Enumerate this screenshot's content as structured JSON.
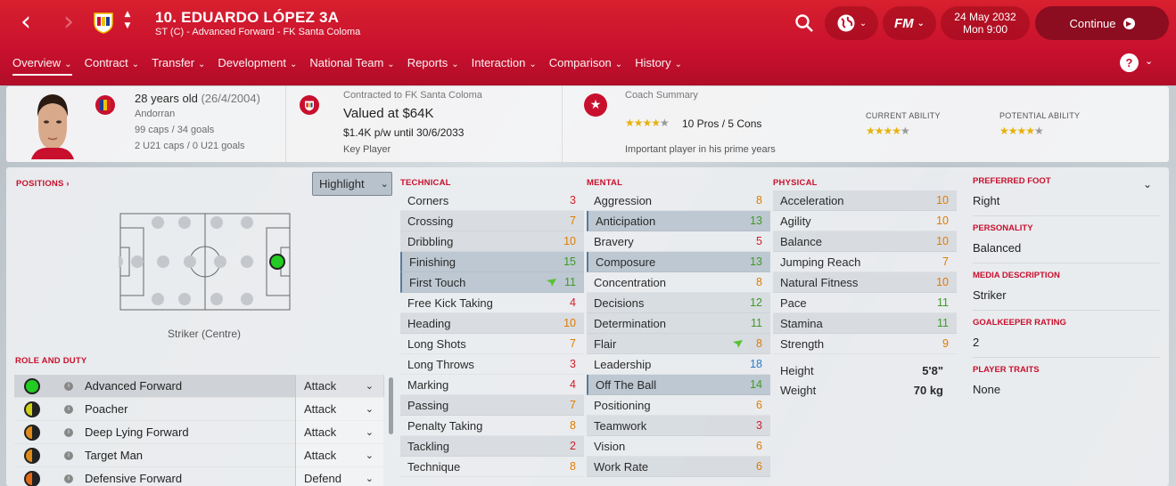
{
  "header": {
    "player_title": "10. EDUARDO LÓPEZ 3A",
    "player_subtitle": "ST (C) - Advanced Forward - FK Santa Coloma",
    "date": "24 May 2032",
    "time": "Mon 9:00",
    "fm_label": "FM",
    "continue_label": "Continue"
  },
  "tabs": [
    "Overview",
    "Contract",
    "Transfer",
    "Development",
    "National Team",
    "Reports",
    "Interaction",
    "Comparison",
    "History"
  ],
  "summary": {
    "age": "28 years old",
    "dob": "(26/4/2004)",
    "nationality": "Andorran",
    "caps": "99 caps / 34 goals",
    "u21_caps": "2 U21 caps / 0 U21 goals",
    "contracted": "Contracted to FK Santa Coloma",
    "value": "Valued at $64K",
    "wage": "$1.4K p/w until 30/6/2033",
    "squad_status": "Key Player",
    "coach_title": "Coach Summary",
    "coach_stars": 4,
    "pros_cons": "10 Pros / 5 Cons",
    "coach_note": "Important player in his prime years",
    "current_ability_label": "CURRENT ABILITY",
    "current_ability_stars": 4,
    "potential_ability_label": "POTENTIAL ABILITY",
    "potential_ability_stars": 4
  },
  "positions": {
    "title": "POSITIONS",
    "highlight_label": "Highlight",
    "position_label": "Striker (Centre)"
  },
  "role_duty": {
    "title": "ROLE AND DUTY",
    "roles": [
      {
        "name": "Advanced Forward",
        "duty": "Attack",
        "color": "#22cc22"
      },
      {
        "name": "Poacher",
        "duty": "Attack",
        "color": "#cfcf1a"
      },
      {
        "name": "Deep Lying Forward",
        "duty": "Attack",
        "color": "#e08a18"
      },
      {
        "name": "Target Man",
        "duty": "Attack",
        "color": "#e08a18"
      },
      {
        "name": "Defensive Forward",
        "duty": "Defend",
        "color": "#e06a18"
      }
    ]
  },
  "technical": {
    "title": "TECHNICAL",
    "attrs": [
      {
        "name": "Corners",
        "value": "3"
      },
      {
        "name": "Crossing",
        "value": "7"
      },
      {
        "name": "Dribbling",
        "value": "10"
      },
      {
        "name": "Finishing",
        "value": "15"
      },
      {
        "name": "First Touch",
        "value": "11"
      },
      {
        "name": "Free Kick Taking",
        "value": "4"
      },
      {
        "name": "Heading",
        "value": "10"
      },
      {
        "name": "Long Shots",
        "value": "7"
      },
      {
        "name": "Long Throws",
        "value": "3"
      },
      {
        "name": "Marking",
        "value": "4"
      },
      {
        "name": "Passing",
        "value": "7"
      },
      {
        "name": "Penalty Taking",
        "value": "8"
      },
      {
        "name": "Tackling",
        "value": "2"
      },
      {
        "name": "Technique",
        "value": "8"
      }
    ]
  },
  "mental": {
    "title": "MENTAL",
    "attrs": [
      {
        "name": "Aggression",
        "value": "8"
      },
      {
        "name": "Anticipation",
        "value": "13"
      },
      {
        "name": "Bravery",
        "value": "5"
      },
      {
        "name": "Composure",
        "value": "13"
      },
      {
        "name": "Concentration",
        "value": "8"
      },
      {
        "name": "Decisions",
        "value": "12"
      },
      {
        "name": "Determination",
        "value": "11"
      },
      {
        "name": "Flair",
        "value": "8"
      },
      {
        "name": "Leadership",
        "value": "18"
      },
      {
        "name": "Off The Ball",
        "value": "14"
      },
      {
        "name": "Positioning",
        "value": "6"
      },
      {
        "name": "Teamwork",
        "value": "3"
      },
      {
        "name": "Vision",
        "value": "6"
      },
      {
        "name": "Work Rate",
        "value": "6"
      }
    ]
  },
  "physical": {
    "title": "PHYSICAL",
    "attrs": [
      {
        "name": "Acceleration",
        "value": "10"
      },
      {
        "name": "Agility",
        "value": "10"
      },
      {
        "name": "Balance",
        "value": "10"
      },
      {
        "name": "Jumping Reach",
        "value": "7"
      },
      {
        "name": "Natural Fitness",
        "value": "10"
      },
      {
        "name": "Pace",
        "value": "11"
      },
      {
        "name": "Stamina",
        "value": "11"
      },
      {
        "name": "Strength",
        "value": "9"
      }
    ],
    "height_label": "Height",
    "height": "5'8\"",
    "weight_label": "Weight",
    "weight": "70 kg"
  },
  "side": {
    "preferred_foot_label": "PREFERRED FOOT",
    "preferred_foot": "Right",
    "personality_label": "PERSONALITY",
    "personality": "Balanced",
    "media_label": "MEDIA DESCRIPTION",
    "media": "Striker",
    "gk_label": "GOALKEEPER RATING",
    "gk": "2",
    "traits_label": "PLAYER TRAITS",
    "traits": "None"
  },
  "colors": {
    "header_red": "#c8102e",
    "attr_red": "#d0202a",
    "attr_orange": "#e07b00",
    "attr_green": "#3f9a27",
    "attr_blue": "#2a7cc9"
  },
  "icons": [
    "back-arrow-icon",
    "forward-arrow-icon",
    "club-crest-icon",
    "search-icon",
    "globe-icon",
    "help-icon",
    "star-icon",
    "info-icon",
    "chevron-down-icon"
  ]
}
